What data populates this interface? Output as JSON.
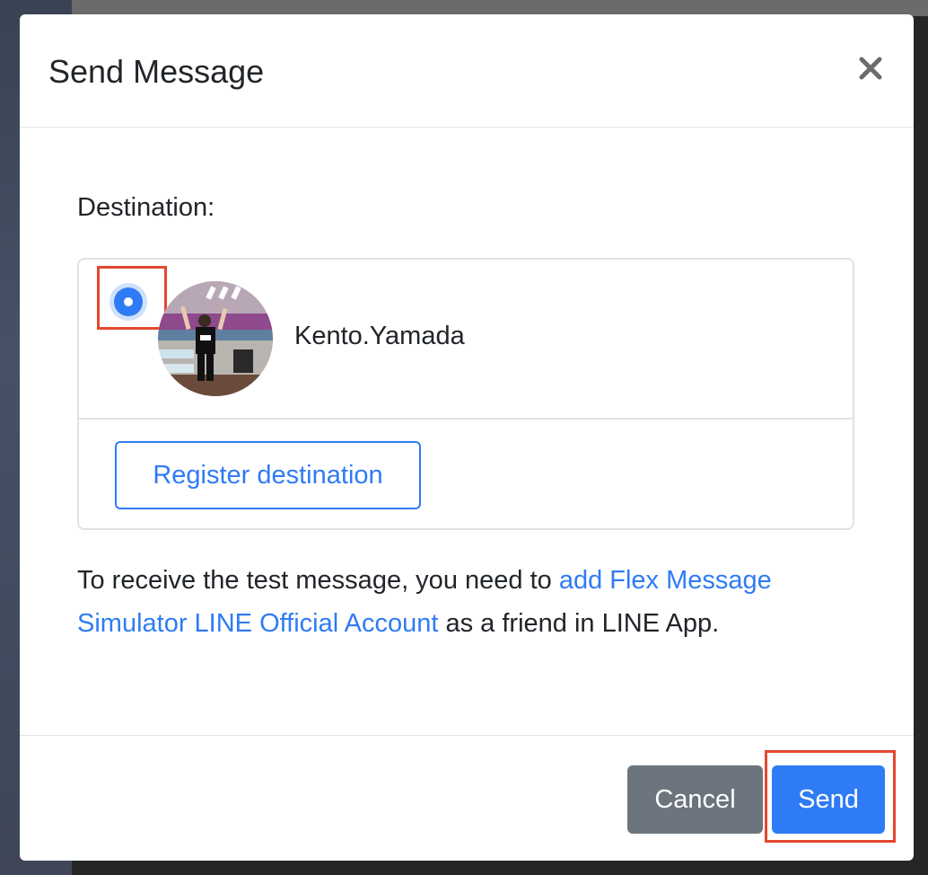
{
  "modal": {
    "title": "Send Message",
    "close_icon": "close-icon"
  },
  "body": {
    "destination_label": "Destination:",
    "destinations": [
      {
        "name": "Kento.Yamada",
        "selected": true,
        "avatar_icon": "user-avatar"
      }
    ],
    "register_button_label": "Register destination",
    "notice": {
      "prefix": "To receive the test message, you need to ",
      "link_text": "add Flex Message Simulator LINE Official Account",
      "suffix": " as a friend in LINE App."
    }
  },
  "footer": {
    "cancel_label": "Cancel",
    "send_label": "Send"
  },
  "colors": {
    "primary": "#2f7bf5",
    "secondary": "#6c757d",
    "highlight": "#e3482f",
    "text": "#212529"
  }
}
